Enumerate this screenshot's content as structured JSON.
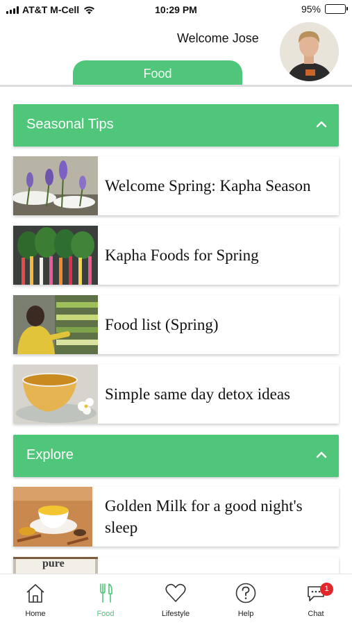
{
  "status_bar": {
    "carrier": "AT&T M-Cell",
    "time": "10:29 PM",
    "battery_percent": "95%",
    "battery_level": 0.95
  },
  "header": {
    "welcome": "Welcome Jose",
    "active_tab": "Food"
  },
  "sections": [
    {
      "title": "Seasonal Tips",
      "items": [
        {
          "title": "Welcome Spring: Kapha Season",
          "thumb": "crocus-flowers"
        },
        {
          "title": "Kapha Foods for Spring",
          "thumb": "rainbow-chard"
        },
        {
          "title": "Food list (Spring)",
          "thumb": "grocery-shopper"
        },
        {
          "title": "Simple same day detox ideas",
          "thumb": "tea-cup"
        }
      ]
    },
    {
      "title": "Explore",
      "items": [
        {
          "title": "Golden Milk for a good night's sleep",
          "thumb": "golden-milk"
        },
        {
          "title": "",
          "thumb": "pure-package",
          "thumb_text": "pure"
        }
      ]
    }
  ],
  "tabbar": [
    {
      "label": "Home",
      "icon": "home-icon"
    },
    {
      "label": "Food",
      "icon": "fork-knife-icon",
      "active": true
    },
    {
      "label": "Lifestyle",
      "icon": "heart-icon"
    },
    {
      "label": "Help",
      "icon": "help-icon"
    },
    {
      "label": "Chat",
      "icon": "chat-icon",
      "badge": "1"
    }
  ],
  "colors": {
    "accent": "#4fc679",
    "badge": "#e3262b"
  }
}
